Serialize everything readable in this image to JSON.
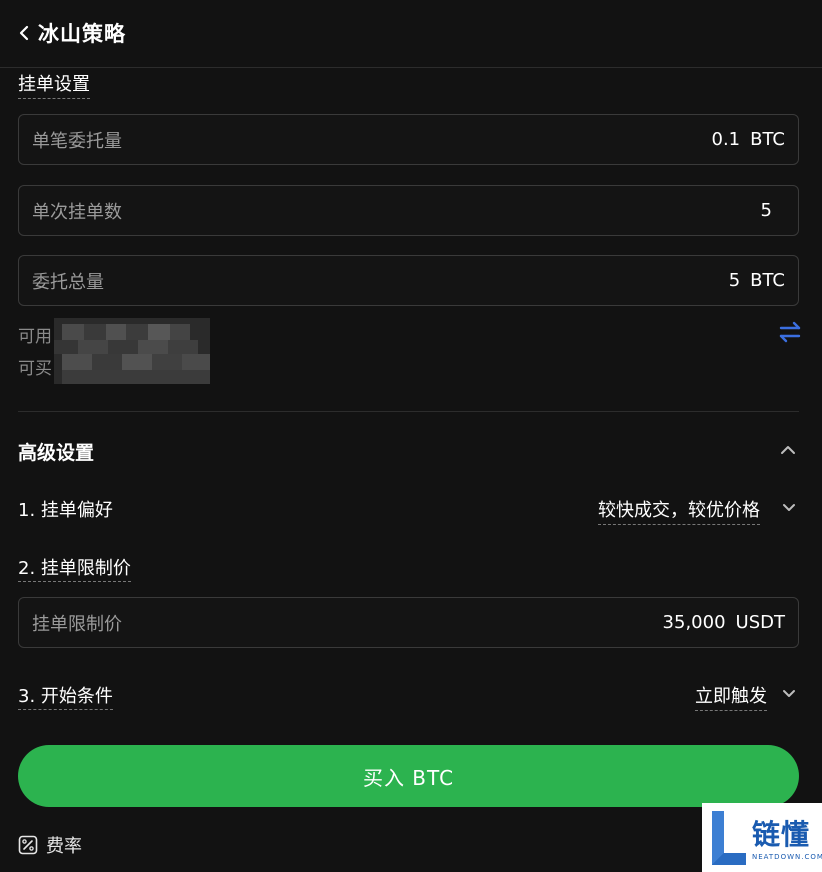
{
  "header": {
    "title": "冰山策略"
  },
  "order_settings": {
    "section_label": "挂单设置",
    "single_amount": {
      "label": "单笔委托量",
      "value": "0.1",
      "unit": "BTC"
    },
    "orders_per_batch": {
      "label": "单次挂单数",
      "value": "5"
    },
    "total_amount": {
      "label": "委托总量",
      "value": "5",
      "unit": "BTC"
    },
    "available_label": "可用",
    "buyable_label": "可买"
  },
  "advanced": {
    "title": "高级设置",
    "preference": {
      "label": "1. 挂单偏好",
      "value": "较快成交，较优价格"
    },
    "limit_price": {
      "label": "2. 挂单限制价",
      "field_label": "挂单限制价",
      "value": "35,000",
      "unit": "USDT"
    },
    "start_condition": {
      "label": "3. 开始条件",
      "value": "立即触发"
    }
  },
  "buy_button": {
    "label": "买入 BTC"
  },
  "fee": {
    "label": "费率"
  },
  "watermark": {
    "brand": "链懂",
    "sub": "NEATDOWN.COM"
  },
  "colors": {
    "accent_green": "#2cb34f",
    "swap_blue": "#3b6fe0",
    "background": "#121212"
  },
  "icons": {
    "back": "chevron-left-icon",
    "swap": "swap-arrows-icon",
    "collapse": "chevron-up-icon",
    "dropdown": "chevron-down-icon",
    "fee": "percent-icon"
  }
}
